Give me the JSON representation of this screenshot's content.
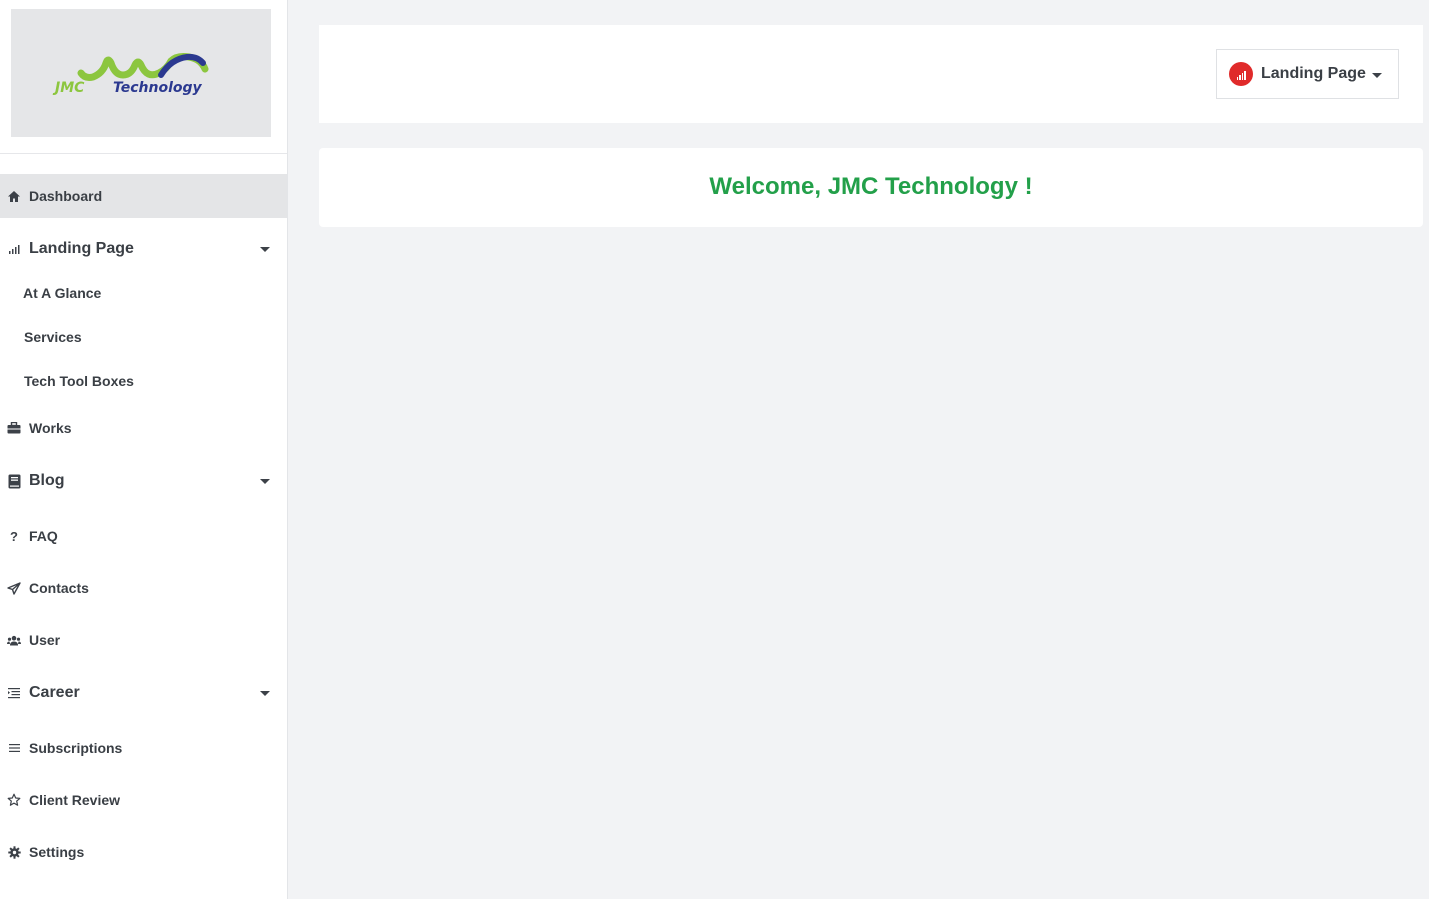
{
  "brand": {
    "logo_mark": "JMC",
    "logo_text": "JMC Technology",
    "colors": {
      "green": "#8cc63f",
      "blue": "#2b3990"
    }
  },
  "sidebar": {
    "items": [
      {
        "label": "Dashboard",
        "icon": "home-icon",
        "active": true
      },
      {
        "label": "Landing Page",
        "icon": "signal-bars-icon",
        "expandable": true,
        "children": [
          "At A Glance",
          "Services",
          "Tech Tool Boxes"
        ]
      },
      {
        "label": "Works",
        "icon": "briefcase-icon"
      },
      {
        "label": "Blog",
        "icon": "book-icon",
        "expandable": true
      },
      {
        "label": "FAQ",
        "icon": "question-icon"
      },
      {
        "label": "Contacts",
        "icon": "paper-plane-icon"
      },
      {
        "label": "User",
        "icon": "users-icon"
      },
      {
        "label": "Career",
        "icon": "list-indent-icon",
        "expandable": true
      },
      {
        "label": "Subscriptions",
        "icon": "list-icon"
      },
      {
        "label": "Client Review",
        "icon": "star-outline-icon"
      },
      {
        "label": "Settings",
        "icon": "gear-icon"
      }
    ]
  },
  "topbar": {
    "dropdown_label": "Landing Page",
    "dropdown_icon": "signal-bars-icon",
    "badge_color": "#e02a2a"
  },
  "main": {
    "welcome": "Welcome, JMC Technology !",
    "welcome_color": "#23a04a"
  }
}
